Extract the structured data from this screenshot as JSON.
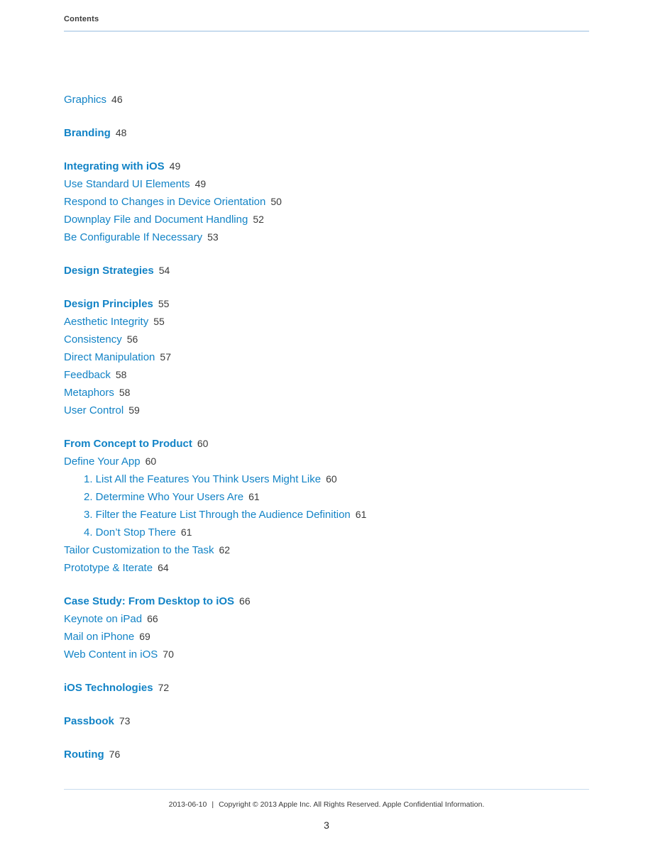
{
  "document": {
    "header_title": "Contents",
    "page_number": "3"
  },
  "colors": {
    "link_blue": "#1283c6",
    "page_number_gray": "#3a3a3a",
    "rule_blue": "#c8dcee",
    "background": "#ffffff"
  },
  "toc": {
    "groups": [
      {
        "entries": [
          {
            "level": 2,
            "label": "Graphics",
            "page": "46"
          }
        ]
      },
      {
        "entries": [
          {
            "level": 1,
            "label": "Branding",
            "page": "48"
          }
        ]
      },
      {
        "entries": [
          {
            "level": 1,
            "label": "Integrating with iOS",
            "page": "49"
          },
          {
            "level": 2,
            "label": "Use Standard UI Elements",
            "page": "49"
          },
          {
            "level": 2,
            "label": "Respond to Changes in Device Orientation",
            "page": "50"
          },
          {
            "level": 2,
            "label": "Downplay File and Document Handling",
            "page": "52"
          },
          {
            "level": 2,
            "label": "Be Configurable If Necessary",
            "page": "53"
          }
        ]
      },
      {
        "entries": [
          {
            "level": 1,
            "label": "Design Strategies",
            "page": "54"
          }
        ]
      },
      {
        "entries": [
          {
            "level": 1,
            "label": "Design Principles",
            "page": "55"
          },
          {
            "level": 2,
            "label": "Aesthetic Integrity",
            "page": "55"
          },
          {
            "level": 2,
            "label": "Consistency",
            "page": "56"
          },
          {
            "level": 2,
            "label": "Direct Manipulation",
            "page": "57"
          },
          {
            "level": 2,
            "label": "Feedback",
            "page": "58"
          },
          {
            "level": 2,
            "label": "Metaphors",
            "page": "58"
          },
          {
            "level": 2,
            "label": "User Control",
            "page": "59"
          }
        ]
      },
      {
        "entries": [
          {
            "level": 1,
            "label": "From Concept to Product",
            "page": "60"
          },
          {
            "level": 2,
            "label": "Define Your App",
            "page": "60"
          },
          {
            "level": 3,
            "label": "1. List All the Features You Think Users Might Like",
            "page": "60"
          },
          {
            "level": 3,
            "label": "2. Determine Who Your Users Are",
            "page": "61"
          },
          {
            "level": 3,
            "label": "3. Filter the Feature List Through the Audience Definition",
            "page": "61"
          },
          {
            "level": 3,
            "label": "4. Don’t Stop There",
            "page": "61"
          },
          {
            "level": 2,
            "label": "Tailor Customization to the Task",
            "page": "62"
          },
          {
            "level": 2,
            "label": "Prototype & Iterate",
            "page": "64"
          }
        ]
      },
      {
        "entries": [
          {
            "level": 1,
            "label": "Case Study: From Desktop to iOS",
            "page": "66"
          },
          {
            "level": 2,
            "label": "Keynote on iPad",
            "page": "66"
          },
          {
            "level": 2,
            "label": "Mail on iPhone",
            "page": "69"
          },
          {
            "level": 2,
            "label": "Web Content in iOS",
            "page": "70"
          }
        ]
      },
      {
        "entries": [
          {
            "level": 1,
            "label": "iOS Technologies",
            "page": "72"
          }
        ]
      },
      {
        "entries": [
          {
            "level": 1,
            "label": "Passbook",
            "page": "73"
          }
        ]
      },
      {
        "entries": [
          {
            "level": 1,
            "label": "Routing",
            "page": "76"
          }
        ]
      }
    ]
  },
  "footer": {
    "date": "2013-06-10",
    "separator": "|",
    "copyright": "Copyright © 2013 Apple Inc. All Rights Reserved. Apple Confidential Information."
  }
}
